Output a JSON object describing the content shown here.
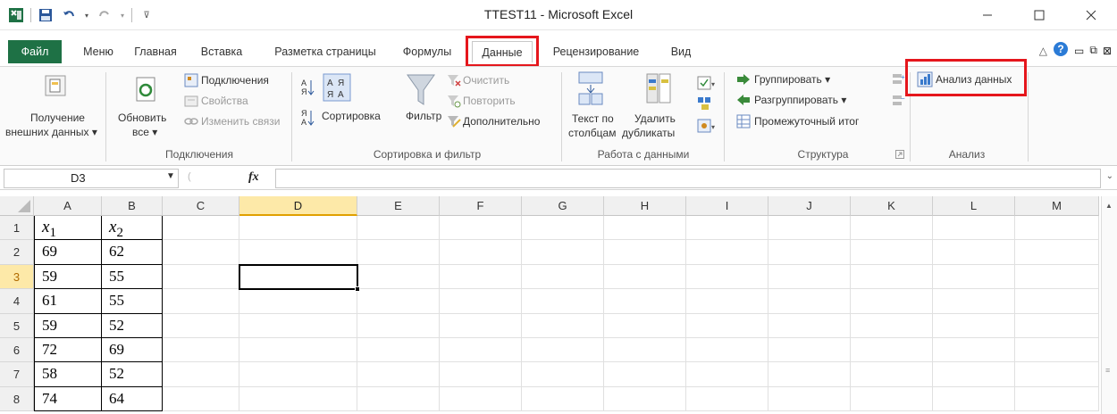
{
  "window": {
    "title": "TTEST11 - Microsoft Excel"
  },
  "tabs": {
    "file": "Файл",
    "menu": "Меню",
    "home": "Главная",
    "insert": "Вставка",
    "layout": "Разметка страницы",
    "formulas": "Формулы",
    "data": "Данные",
    "review": "Рецензирование",
    "view": "Вид"
  },
  "ribbon": {
    "get_external_1": "Получение",
    "get_external_2": "внешних данных ▾",
    "refresh_1": "Обновить",
    "refresh_2": "все ▾",
    "connections": "Подключения",
    "properties": "Свойства",
    "edit_links": "Изменить связи",
    "group_connections": "Подключения",
    "sort": "Сортировка",
    "filter": "Фильтр",
    "clear": "Очистить",
    "reapply": "Повторить",
    "advanced": "Дополнительно",
    "group_sort": "Сортировка и фильтр",
    "text_to_columns_1": "Текст по",
    "text_to_columns_2": "столбцам",
    "remove_dup_1": "Удалить",
    "remove_dup_2": "дубликаты",
    "group_data_tools": "Работа с данными",
    "group_btn": "Группировать ▾",
    "ungroup_btn": "Разгруппировать ▾",
    "subtotal": "Промежуточный итог",
    "group_outline": "Структура",
    "data_analysis": "Анализ данных",
    "group_analysis": "Анализ"
  },
  "formula_bar": {
    "name_box": "D3",
    "fx": "fx",
    "value": ""
  },
  "sheet": {
    "columns": [
      "A",
      "B",
      "C",
      "D",
      "E",
      "F",
      "G",
      "H",
      "I",
      "J",
      "K",
      "L",
      "M"
    ],
    "rows": [
      "1",
      "2",
      "3",
      "4",
      "5",
      "6",
      "7",
      "8"
    ],
    "header_x1": "x1",
    "header_x2": "x2",
    "col_a": [
      "69",
      "59",
      "61",
      "59",
      "72",
      "58",
      "74"
    ],
    "col_b": [
      "62",
      "55",
      "55",
      "52",
      "69",
      "52",
      "64"
    ],
    "selected_cell": "D3"
  },
  "colors": {
    "file_tab": "#1e7145",
    "highlight": "#e5161c",
    "selection_header": "#fde9a8"
  }
}
